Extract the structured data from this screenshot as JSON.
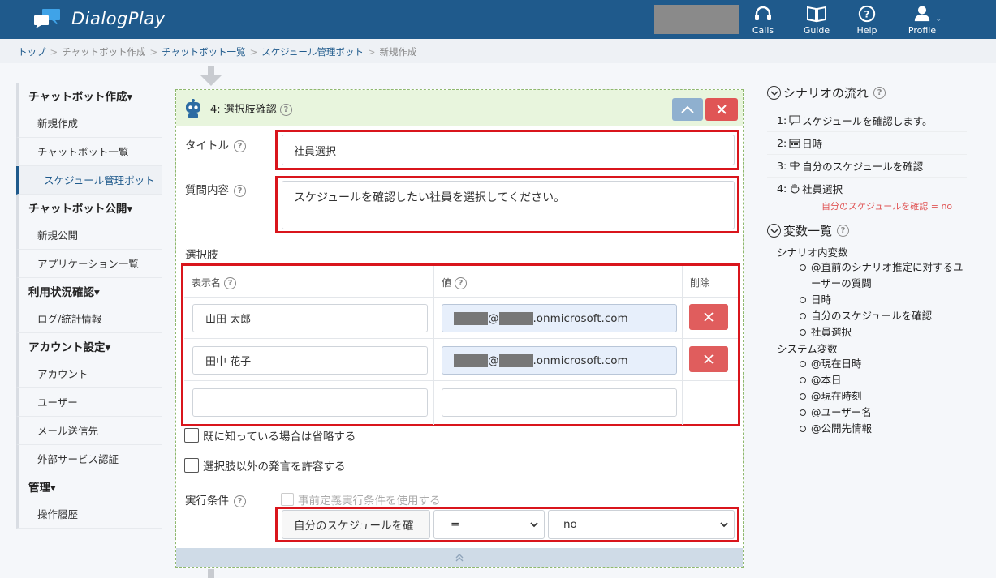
{
  "app": {
    "name": "DialogPlay"
  },
  "header": {
    "items": [
      {
        "label": "Calls",
        "icon": "headset-icon"
      },
      {
        "label": "Guide",
        "icon": "book-icon"
      },
      {
        "label": "Help",
        "icon": "help-icon"
      },
      {
        "label": "Profile",
        "icon": "user-icon"
      }
    ]
  },
  "breadcrumb": [
    "トップ",
    "チャットボット作成",
    "チャットボット一覧",
    "スケジュール管理ボット",
    "新規作成"
  ],
  "nav": {
    "g1": "チャットボット作成▾",
    "g1_items": [
      "新規作成",
      "チャットボット一覧",
      "スケジュール管理ボット"
    ],
    "g2": "チャットボット公開▾",
    "g2_items": [
      "新規公開",
      "アプリケーション一覧"
    ],
    "g3": "利用状況確認▾",
    "g3_items": [
      "ログ/統計情報"
    ],
    "g4": "アカウント設定▾",
    "g4_items": [
      "アカウント",
      "ユーザー",
      "メール送信先",
      "外部サービス認証"
    ],
    "g5": "管理▾",
    "g5_items": [
      "操作履歴"
    ]
  },
  "card": {
    "title": "4: 選択肢確認",
    "title_label": "タイトル",
    "title_value": "社員選択",
    "question_label": "質問内容",
    "question_value": "スケジュールを確認したい社員を選択してください。",
    "choices_label": "選択肢",
    "col_name": "表示名",
    "col_value": "値",
    "col_delete": "削除",
    "rows": [
      {
        "name": "山田 太郎",
        "value_suffix": ".onmicrosoft.com",
        "at": "@"
      },
      {
        "name": "田中 花子",
        "value_suffix": ".onmicrosoft.com",
        "at": "@"
      }
    ],
    "skip_label": "既に知っている場合は省略する",
    "allow_label": "選択肢以外の発言を許容する",
    "cond_label": "実行条件",
    "predef_label": "事前定義実行条件を使用する",
    "cond_var": "自分のスケジュールを確",
    "cond_op": "=",
    "cond_val": "no"
  },
  "flow": {
    "title": "シナリオの流れ",
    "steps": [
      {
        "num": "1:",
        "icon": "speech-icon",
        "text": "スケジュールを確認します。"
      },
      {
        "num": "2:",
        "icon": "calendar-icon",
        "text": "日時"
      },
      {
        "num": "3:",
        "icon": "signpost-icon",
        "text": "自分のスケジュールを確認"
      },
      {
        "num": "4:",
        "icon": "hand-icon",
        "text": "社員選択"
      }
    ],
    "cond_note": "自分のスケジュールを確認 = no"
  },
  "vars": {
    "title": "変数一覧",
    "scenario_label": "シナリオ内変数",
    "scenario": [
      "@直前のシナリオ推定に対するユーザーの質問",
      "日時",
      "自分のスケジュールを確認",
      "社員選択"
    ],
    "system_label": "システム変数",
    "system": [
      "@現在日時",
      "@本日",
      "@現在時刻",
      "@ユーザー名",
      "@公開先情報"
    ]
  },
  "colors": {
    "brand": "#1f5a8c",
    "danger": "#e05555",
    "highlight": "#d9151c"
  }
}
